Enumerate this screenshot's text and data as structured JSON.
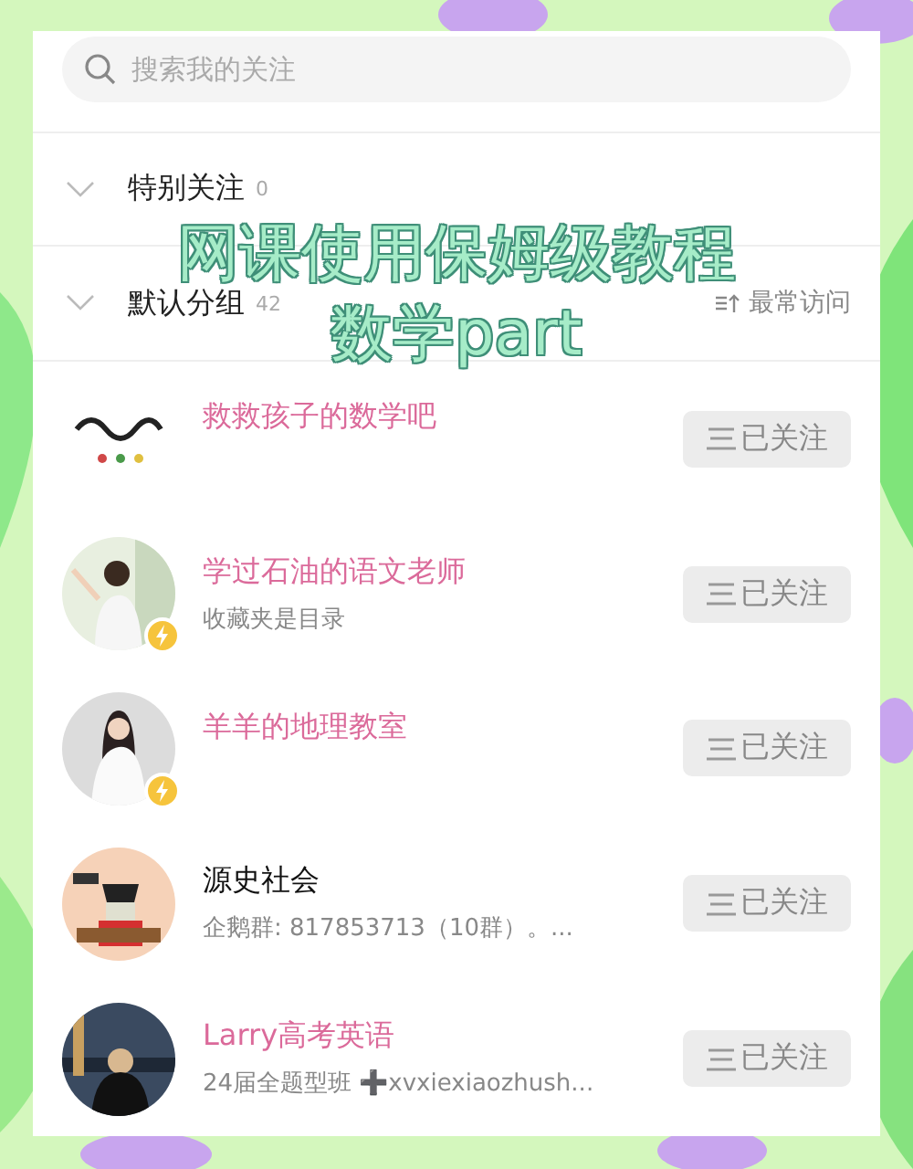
{
  "search": {
    "placeholder": "搜索我的关注"
  },
  "groups": [
    {
      "name": "特别关注",
      "count": "0"
    },
    {
      "name": "默认分组",
      "count": "42",
      "sort_label": "最常访问"
    }
  ],
  "overlay_title": {
    "lines": [
      "网课使用保姆级教程",
      "数学part"
    ]
  },
  "follows": [
    {
      "name": "救救孩子的数学吧",
      "vip": true,
      "badge": false,
      "button": "已关注"
    },
    {
      "name": "学过石油的语文老师",
      "vip": true,
      "badge": true,
      "subtitle": "收藏夹是目录",
      "button": "已关注"
    },
    {
      "name": "羊羊的地理教室",
      "vip": true,
      "badge": true,
      "button": "已关注"
    },
    {
      "name": "源史社会",
      "vip": false,
      "badge": false,
      "subtitle": "企鹅群: 817853713（10群）。...",
      "button": "已关注"
    },
    {
      "name": "Larry高考英语",
      "vip": true,
      "badge": false,
      "subtitle": "24届全题型班 ➕xvxiexiaozhush...",
      "button": "已关注"
    }
  ]
}
